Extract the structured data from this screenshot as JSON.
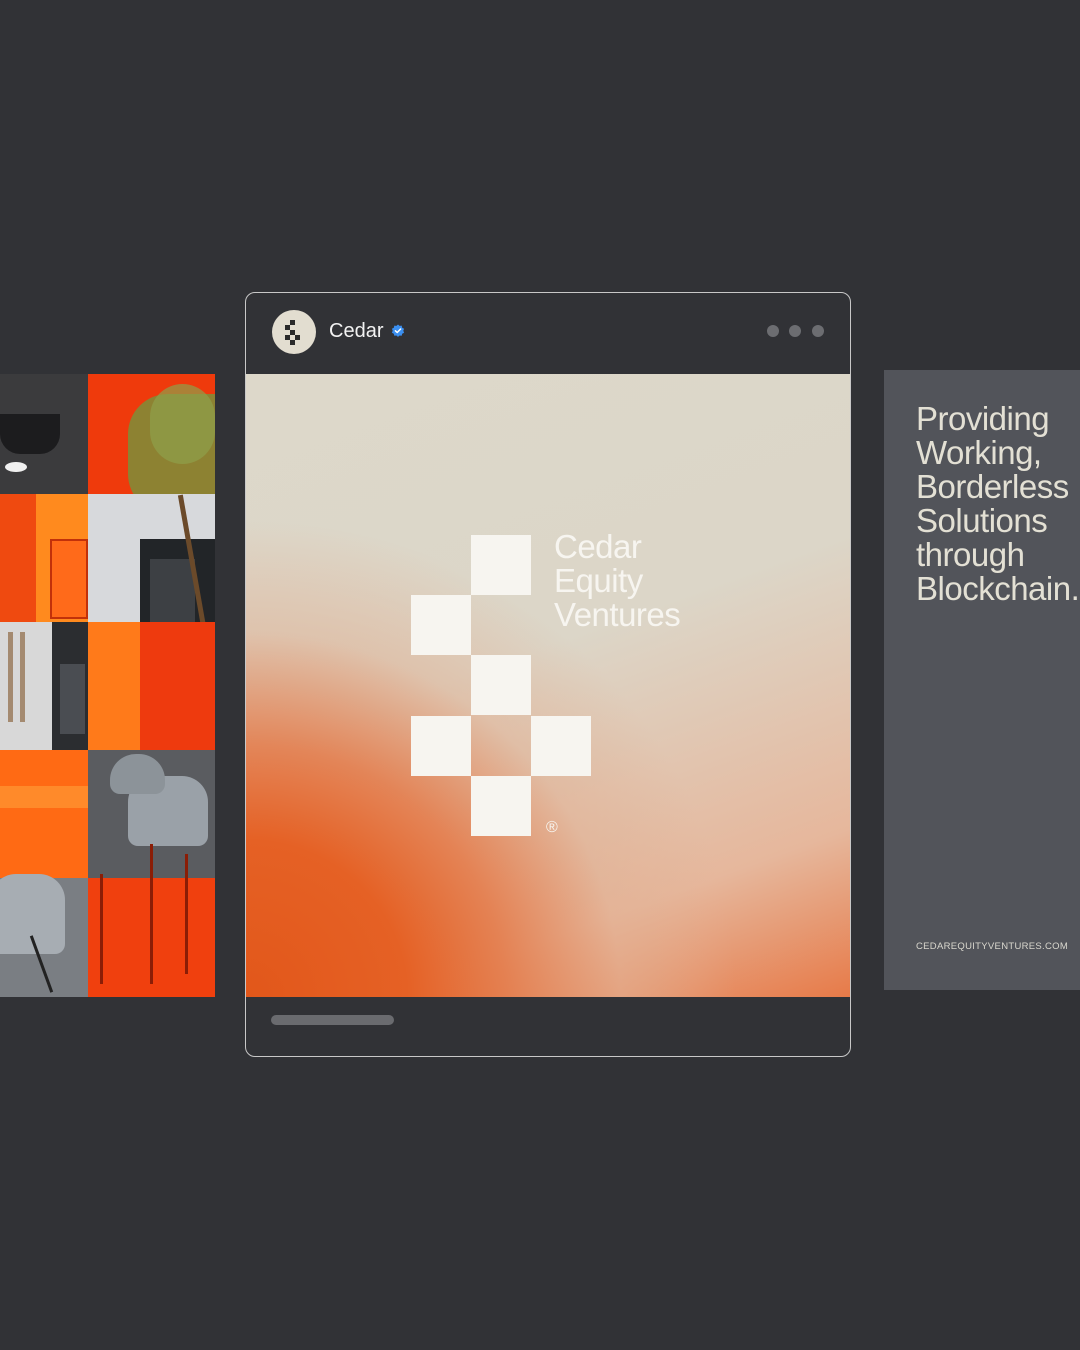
{
  "post": {
    "username": "Cedar",
    "verified": true,
    "more_icon": "more-horizontal-icon",
    "logo": {
      "name_lines": [
        "Cedar",
        "Equity",
        "Ventures"
      ],
      "registered_mark": "®"
    },
    "carousel_progress": 1.0
  },
  "next_slide": {
    "headline_lines": [
      "Providing",
      "Working,",
      "Borderless",
      "Solutions",
      "through",
      "Blockchain."
    ],
    "website": "CEDAREQUITYVENTURES.COM"
  },
  "colors": {
    "background": "#313236",
    "accent_orange": "#e2571a",
    "cream": "#ddd8ca",
    "slide_gray": "#52545a",
    "verified_blue": "#3b8ff0"
  }
}
